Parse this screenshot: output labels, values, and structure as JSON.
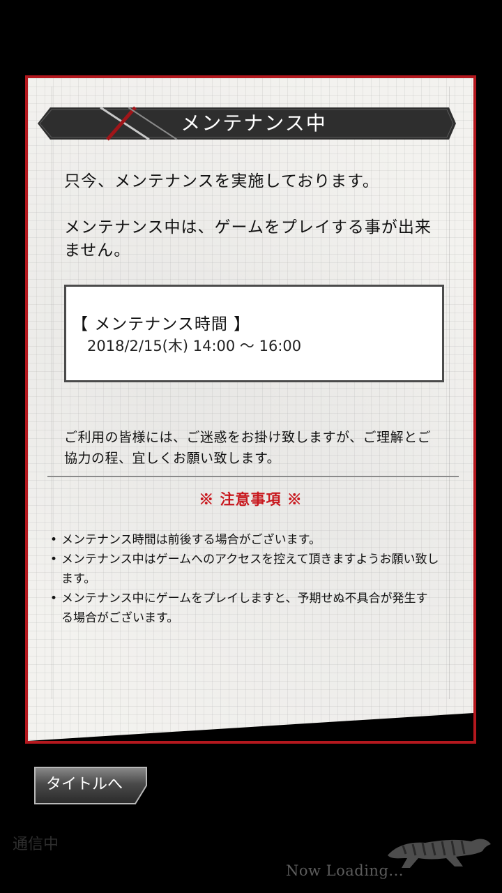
{
  "dialog": {
    "title": "メンテナンス中",
    "message1": "只今、メンテナンスを実施しております。",
    "message2": "メンテナンス中は、ゲームをプレイする事が出来ません。",
    "schedule": {
      "heading": "【 メンテナンス時間 】",
      "time": "2018/2/15(木) 14:00 ～ 16:00"
    },
    "apology": "ご利用の皆様には、ご迷惑をお掛け致しますが、ご理解とご協力の程、宜しくお願い致します。",
    "notice_title": "※ 注意事項 ※",
    "notes": [
      "メンテナンス時間は前後する場合がございます。",
      "メンテナンス中はゲームへのアクセスを控えて頂きますようお願い致します。",
      "メンテナンス中にゲームをプレイしますと、予期せぬ不具合が発生する場合がございます。"
    ]
  },
  "buttons": {
    "to_title": "タイトルへ"
  },
  "status": {
    "connecting": "通信中",
    "loading": "Now Loading..."
  },
  "icons": {
    "loading_icon": "tiger-icon"
  },
  "colors": {
    "accent": "#b4181e",
    "notice": "#c8181e",
    "background": "#000000"
  }
}
